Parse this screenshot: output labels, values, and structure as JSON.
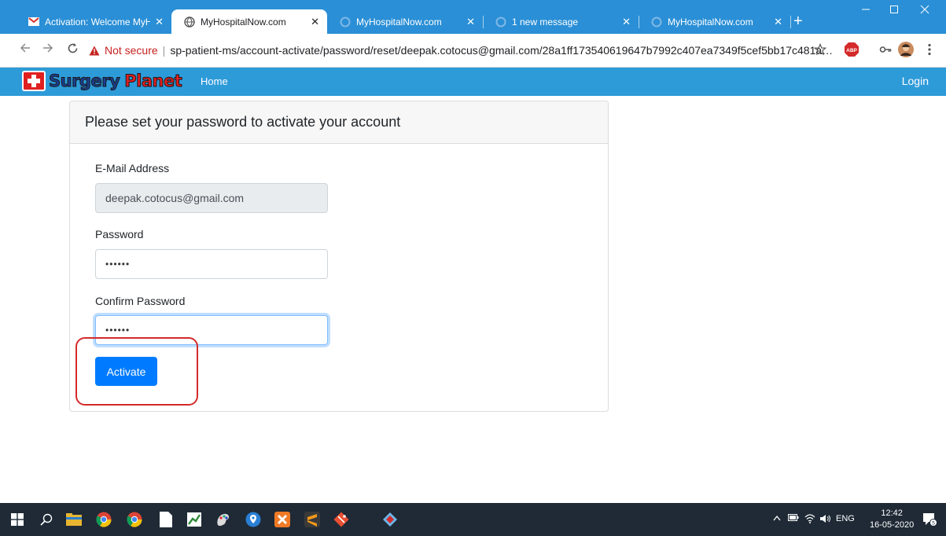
{
  "browser": {
    "tabs": [
      {
        "title": "Activation: Welcome MyHo",
        "icon": "gmail-icon",
        "close": "✕"
      },
      {
        "title": "MyHospitalNow.com",
        "icon": "globe-icon",
        "close": "✕"
      },
      {
        "title": "MyHospitalNow.com",
        "icon": "loading-icon",
        "close": "✕"
      },
      {
        "title": "1 new message",
        "icon": "loading-icon",
        "close": "✕"
      },
      {
        "title": "MyHospitalNow.com",
        "icon": "loading-icon",
        "close": "✕"
      }
    ],
    "new_tab": "+",
    "address": {
      "security_label": "Not secure",
      "separator": "|",
      "url": "sp-patient-ms/account-activate/password/reset/deepak.cotocus@gmail.com/28a1ff173540619647b7992c407ea7349f5cef5bb17c481ab..."
    },
    "extension_badge": "ABP"
  },
  "site": {
    "brand_part1": "Surgery",
    "brand_part2": "Planet",
    "nav_home": "Home",
    "nav_login": "Login",
    "accent_color": "#2e9bd9"
  },
  "form": {
    "title": "Please set your password to activate your account",
    "email_label": "E-Mail Address",
    "email_value": "deepak.cotocus@gmail.com",
    "password_label": "Password",
    "password_value": "••••••",
    "confirm_label": "Confirm Password",
    "confirm_value": "••••••",
    "submit_label": "Activate",
    "button_color": "#007bff"
  },
  "taskbar": {
    "language": "ENG",
    "time": "12:42",
    "date": "16-05-2020",
    "notification_count": "5"
  }
}
